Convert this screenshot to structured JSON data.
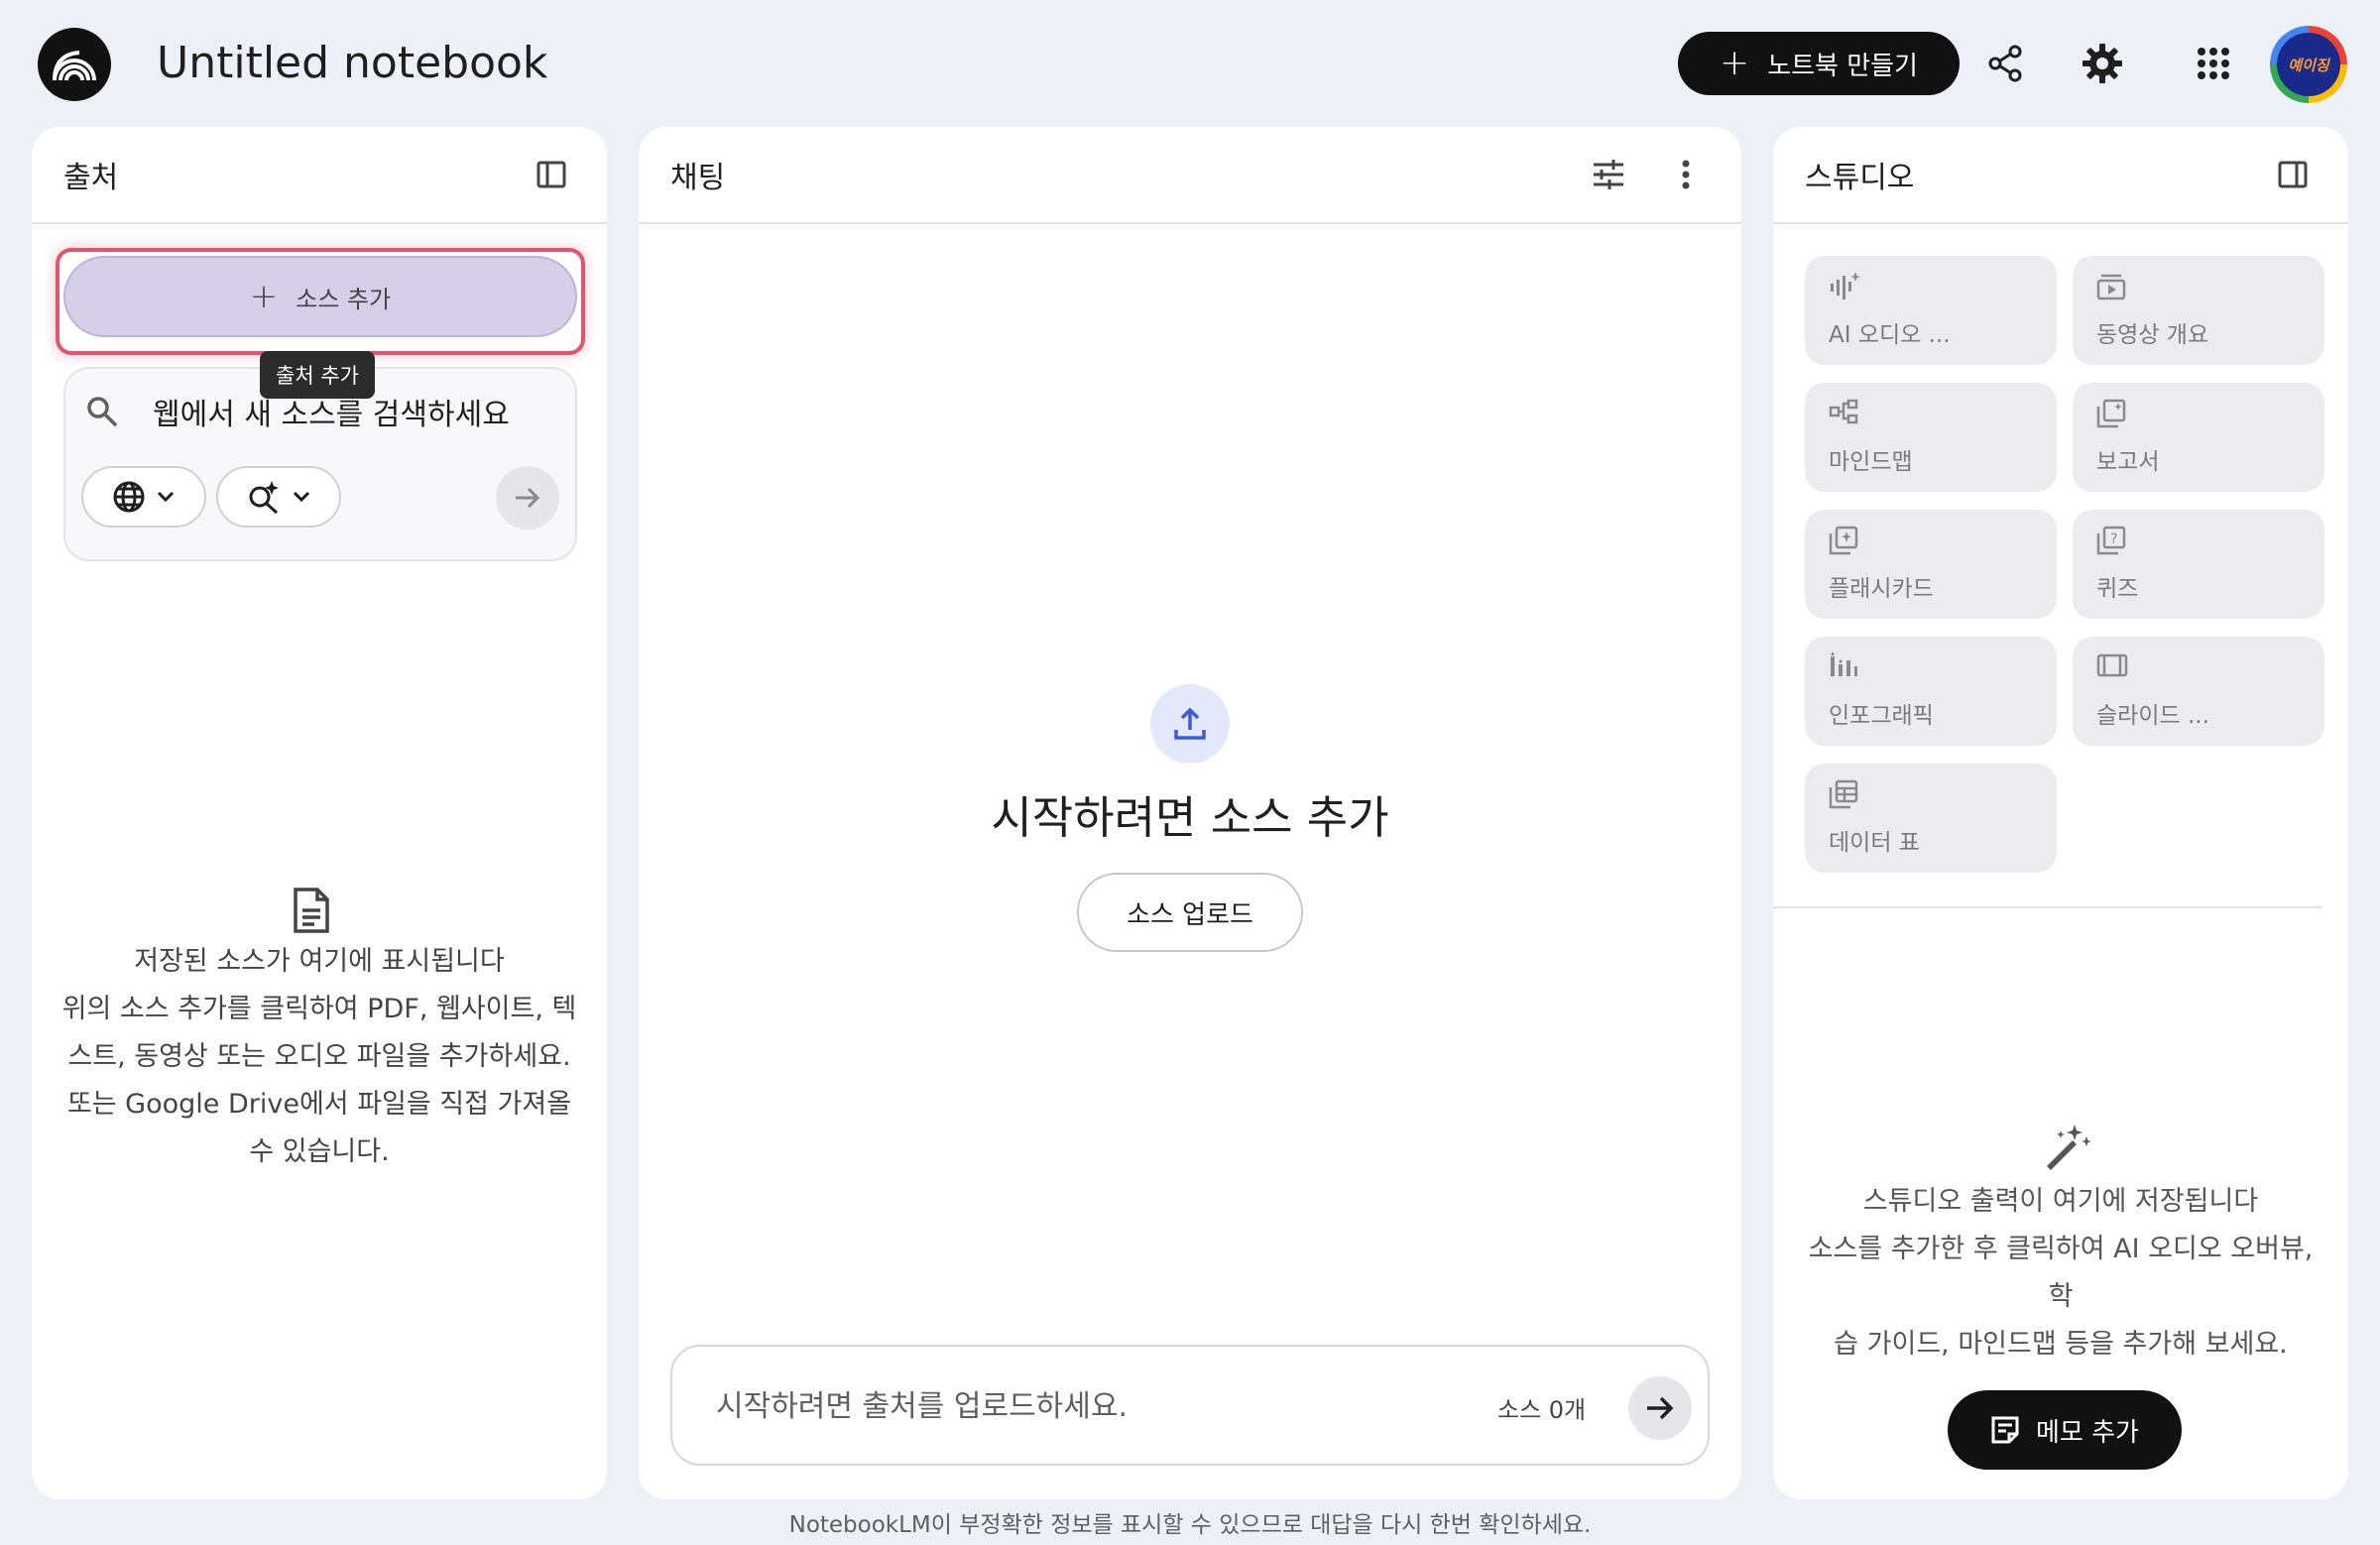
{
  "header": {
    "title": "Untitled notebook",
    "create_label": "노트북 만들기",
    "avatar_text": "예이징"
  },
  "sources": {
    "title": "출처",
    "add_label": "소스 추가",
    "tooltip": "출처 추가",
    "search_placeholder": "웹에서 새 소스를 검색하세요",
    "empty_title": "저장된 소스가 여기에 표시됩니다",
    "empty_line1": "위의 소스 추가를 클릭하여 PDF, 웹사이트, 텍",
    "empty_line2": "스트, 동영상 또는 오디오 파일을 추가하세요.",
    "empty_line3": "또는 Google Drive에서 파일을 직접 가져올",
    "empty_line4": "수 있습니다."
  },
  "chat": {
    "title": "채팅",
    "headline": "시작하려면 소스 추가",
    "upload_label": "소스 업로드",
    "input_placeholder": "시작하려면 출처를 업로드하세요.",
    "source_count": "소스 0개"
  },
  "studio": {
    "title": "스튜디오",
    "tiles": [
      {
        "label": "AI 오디오 ...",
        "icon": "audio-icon"
      },
      {
        "label": "동영상 개요",
        "icon": "video-icon"
      },
      {
        "label": "마인드맵",
        "icon": "mindmap-icon"
      },
      {
        "label": "보고서",
        "icon": "report-icon"
      },
      {
        "label": "플래시카드",
        "icon": "flashcard-icon"
      },
      {
        "label": "퀴즈",
        "icon": "quiz-icon"
      },
      {
        "label": "인포그래픽",
        "icon": "infographic-icon"
      },
      {
        "label": "슬라이드 ...",
        "icon": "slides-icon"
      },
      {
        "label": "데이터 표",
        "icon": "table-icon"
      }
    ],
    "empty_title": "스튜디오 출력이 여기에 저장됩니다",
    "empty_line1": "소스를 추가한 후 클릭하여 AI 오디오 오버뷰, 학",
    "empty_line2": "습 가이드, 마인드맵 등을 추가해 보세요.",
    "memo_label": "메모 추가"
  },
  "footer": {
    "disclaimer": "NotebookLM이 부정확한 정보를 표시할 수 있으므로 대답을 다시 한번 확인하세요."
  },
  "colors": {
    "background": "#eef0f8",
    "accent_dark": "#111111",
    "highlight_border": "#e0566e",
    "add_source_fill": "#d5cfe8",
    "upload_accent": "#3b5bdb"
  }
}
